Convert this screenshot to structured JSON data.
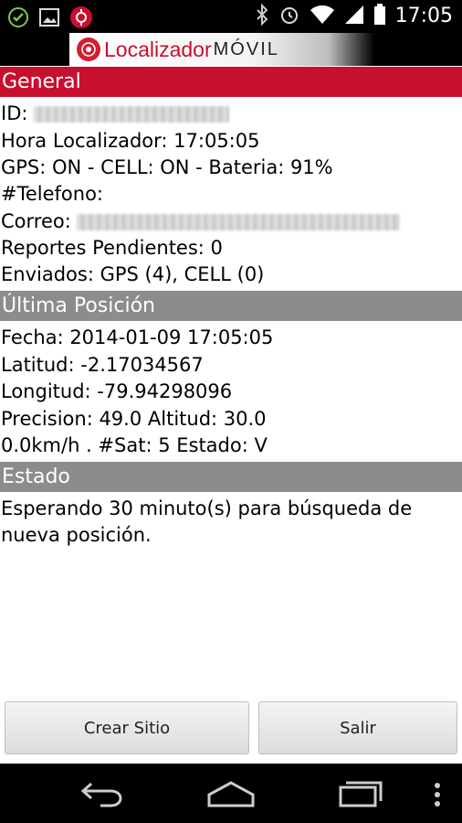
{
  "status_bar": {
    "time": "17:05",
    "icons": [
      "check-circle-icon",
      "image-icon",
      "app-notification-icon",
      "bluetooth-icon",
      "alarm-icon",
      "wifi-icon",
      "signal-icon",
      "battery-icon"
    ]
  },
  "app": {
    "logo_word1": "Localizador",
    "logo_word2": "MÓVIL"
  },
  "general": {
    "header": "General",
    "id_label": "ID:",
    "hora_localizador": "Hora Localizador: 17:05:05",
    "gps_cell_bateria": "GPS: ON - CELL: ON - Bateria: 91%",
    "telefono": "#Telefono:",
    "correo_label": "Correo:",
    "reportes_pendientes": "Reportes Pendientes: 0",
    "enviados": "Enviados: GPS (4), CELL (0)"
  },
  "ultima_posicion": {
    "header": "Última Posición",
    "fecha": "Fecha: 2014-01-09 17:05:05",
    "latitud": "Latitud: -2.17034567",
    "longitud": "Longitud: -79.94298096",
    "precision_altitud": "Precision: 49.0 Altitud: 30.0",
    "velocidad_sat_estado": "0.0km/h . #Sat: 5 Estado: V"
  },
  "estado": {
    "header": "Estado",
    "line1": "Esperando 30 minuto(s) para búsqueda de",
    "line2": "nueva posición."
  },
  "buttons": {
    "crear_sitio": "Crear Sitio",
    "salir": "Salir"
  },
  "nav": {
    "icons": [
      "back-icon",
      "home-icon",
      "recents-icon",
      "menu-dots-icon"
    ]
  },
  "colors": {
    "accent_red": "#c8102e",
    "section_gray": "#8c8c8c"
  }
}
